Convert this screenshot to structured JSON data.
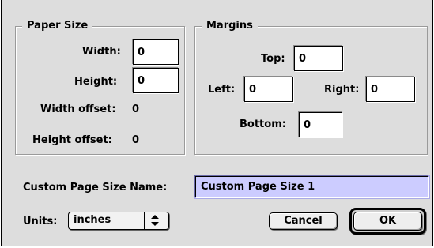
{
  "paper_size": {
    "legend": "Paper Size",
    "width_label": "Width:",
    "width_value": "0",
    "height_label": "Height:",
    "height_value": "0",
    "width_offset_label": "Width offset:",
    "width_offset_value": "0",
    "height_offset_label": "Height offset:",
    "height_offset_value": "0"
  },
  "margins": {
    "legend": "Margins",
    "top_label": "Top:",
    "top_value": "0",
    "left_label": "Left:",
    "left_value": "0",
    "right_label": "Right:",
    "right_value": "0",
    "bottom_label": "Bottom:",
    "bottom_value": "0"
  },
  "custom_name": {
    "label": "Custom Page Size Name:",
    "value": "Custom Page Size 1"
  },
  "units": {
    "label": "Units:",
    "selected": "inches",
    "arrows_icon": "up-down-arrows-icon"
  },
  "buttons": {
    "cancel": "Cancel",
    "ok": "OK"
  },
  "colors": {
    "dialog_background": "#dddddd",
    "selected_field": "#ccccff"
  }
}
